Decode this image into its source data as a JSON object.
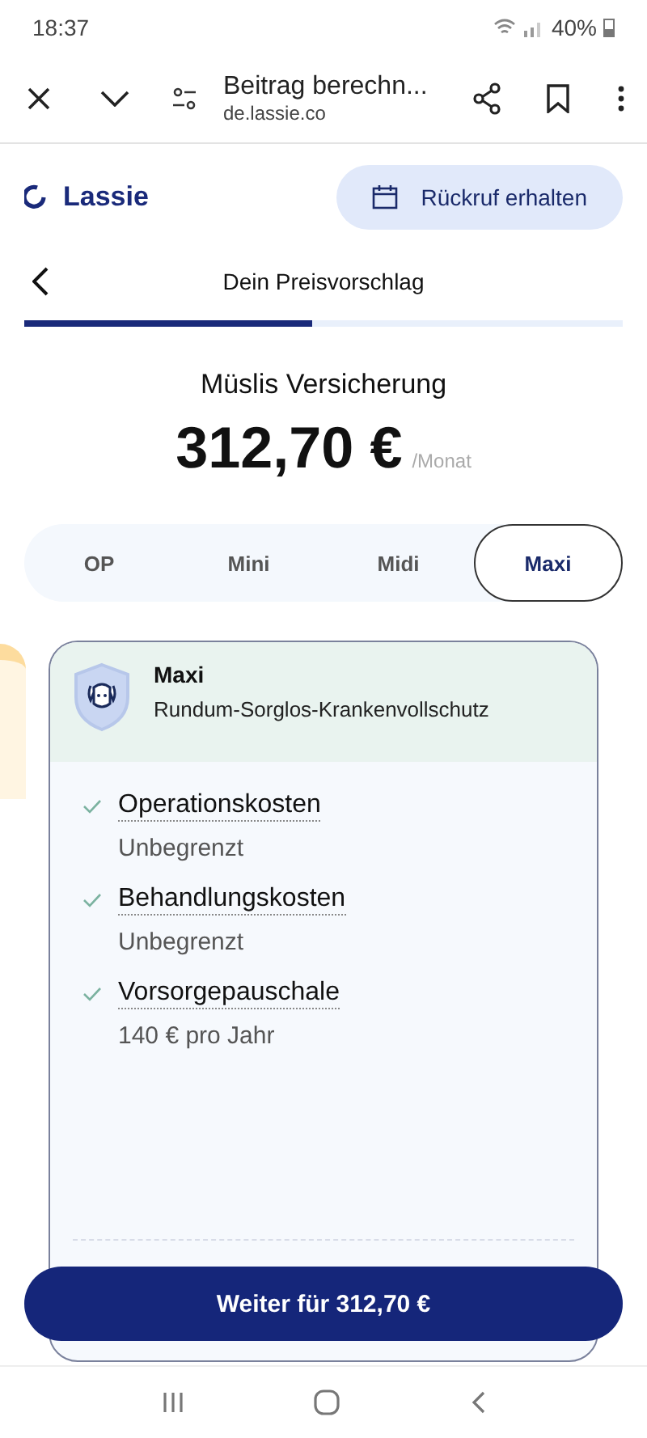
{
  "status_bar": {
    "time": "18:37",
    "battery": "40%"
  },
  "browser": {
    "title": "Beitrag berechn...",
    "url": "de.lassie.co"
  },
  "header": {
    "logo": "Lassie",
    "callback_button": "Rückruf erhalten"
  },
  "nav": {
    "title": "Dein Preisvorschlag",
    "progress": {
      "level": 0.48
    }
  },
  "quote": {
    "title": "Müslis Versicherung",
    "price": "312,70 €",
    "period": "/Monat"
  },
  "tabs": [
    {
      "label": "OP",
      "selected": false
    },
    {
      "label": "Mini",
      "selected": false
    },
    {
      "label": "Midi",
      "selected": false
    },
    {
      "label": "Maxi",
      "selected": true
    }
  ],
  "plan": {
    "name": "Maxi",
    "subtitle": "Rundum-Sorglos-Krankenvollschutz",
    "features": [
      {
        "label": "Operationskosten",
        "value": "Unbegrenzt"
      },
      {
        "label": "Behandlungskosten",
        "value": "Unbegrenzt"
      },
      {
        "label": "Vorsorgepauschale",
        "value": "140 € pro Jahr"
      }
    ]
  },
  "continue_button": "Weiter für 312,70 €"
}
